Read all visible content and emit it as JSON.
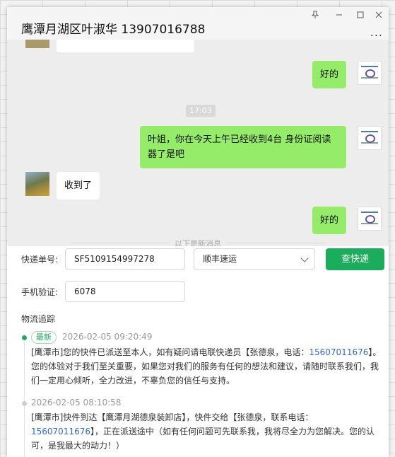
{
  "window": {
    "title": "鹰潭月湖区叶淑华 13907016788",
    "controls": [
      "pin-icon",
      "minimize-icon",
      "maximize-icon",
      "close-icon"
    ],
    "more": "..."
  },
  "chat": {
    "messages": [
      {
        "side": "self",
        "text": "好的"
      },
      {
        "side": "time",
        "text": "17:03"
      },
      {
        "side": "self",
        "text": "叶姐，你在今天上午已经收到4台 身份证阅读器了是吧"
      },
      {
        "side": "other",
        "text": "收到了"
      },
      {
        "side": "self",
        "text": "好的"
      }
    ],
    "new_divider": "以下是新消息"
  },
  "query": {
    "tracking_label": "快递单号:",
    "tracking_value": "SF5109154997278",
    "courier_value": "顺丰速运",
    "query_button": "查快递",
    "phone_label": "手机验证:",
    "phone_value": "6078"
  },
  "tracking": {
    "title": "物流追踪",
    "events": [
      {
        "tag": "最新",
        "time": "2026-02-05 09:20:49",
        "text_a": "[鹰潭市]您的快件已派送至本人，如有疑问请电联快递员【张德泉，电话：",
        "phone": "15607011676",
        "text_b": "】。您的体验对于我们至关重要，如果您对我们的服务有任何的想法和建议，请随时联系我们，我们一定用心倾听，全力改进，不辜负您的信任与支持。"
      },
      {
        "time": "2026-02-05 08:10:58",
        "text_a": "[鹰潭市]快件到达【鹰潭月湖德泉装卸店】，快件交给【张德泉，联系电话：",
        "phone": "15607011676",
        "text_b": "】，正在派送途中（如有任何问题可先联系我，我将尽全力为您解决。您的认可，是我最大的动力！）"
      }
    ]
  },
  "colors": {
    "accent": "#1aad5b",
    "self_bubble": "#95ec69",
    "phone_link": "#2e6ad1"
  }
}
